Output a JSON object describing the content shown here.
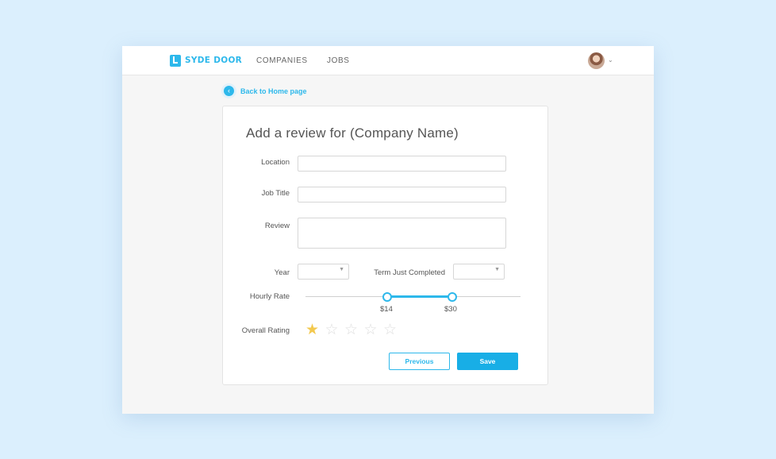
{
  "header": {
    "brand": "SYDE DOOR",
    "nav": [
      "COMPANIES",
      "JOBS"
    ],
    "avatar_caret": "⌄"
  },
  "back_link": {
    "icon": "‹",
    "label": "Back to Home page"
  },
  "form": {
    "title": "Add a review for (Company Name)",
    "location_label": "Location",
    "location_value": "",
    "job_title_label": "Job Title",
    "job_title_value": "",
    "review_label": "Review",
    "review_value": "",
    "year_label": "Year",
    "year_value": "",
    "term_label": "Term Just Completed",
    "term_value": "",
    "select_arrow": "▼",
    "hourly_rate_label": "Hourly Rate",
    "hourly_rate_min": "$14",
    "hourly_rate_max": "$30",
    "overall_rating_label": "Overall Rating",
    "rating": 1,
    "rating_max": 5,
    "previous_label": "Previous",
    "save_label": "Save"
  },
  "colors": {
    "accent": "#2db8eb",
    "star": "#f3c94f",
    "background": "#dbeffd"
  },
  "icons": {
    "logo": "syde-door-logo-icon",
    "back": "chevron-left-icon",
    "star": "star-icon"
  }
}
